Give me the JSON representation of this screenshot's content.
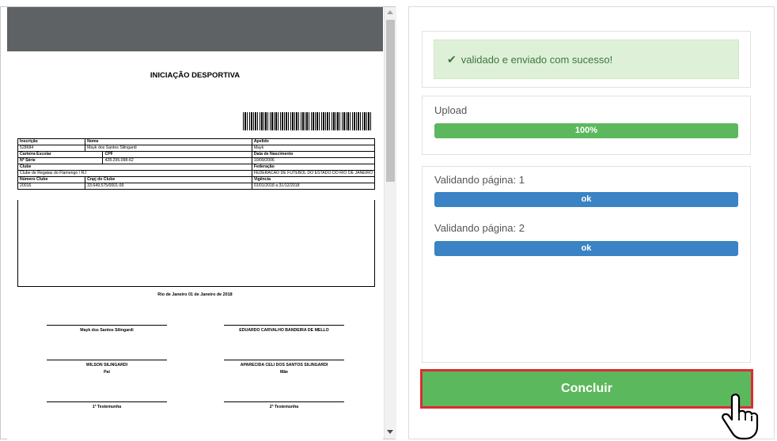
{
  "document": {
    "title": "INICIAÇÃO DESPORTIVA",
    "rows": [
      [
        {
          "t": "Inscrição",
          "h": true
        },
        {
          "t": "Nome",
          "h": true,
          "c": 2
        },
        {
          "t": "Apelido",
          "h": true
        }
      ],
      [
        {
          "t": "528684"
        },
        {
          "t": "Mayk dos Santos Silingardi",
          "c": 2
        },
        {
          "t": "Mayk"
        }
      ],
      [
        {
          "t": "Carteira Escolar",
          "h": true,
          "c": 2
        },
        {
          "t": "CPF",
          "h": true
        },
        {
          "t": "Data de Nascimento",
          "h": true
        }
      ],
      [
        {
          "t": "Nº Série",
          "h": true,
          "c": 2
        },
        {
          "t": "428.295.098-62"
        },
        {
          "t": "10/09/2006"
        }
      ],
      [
        {
          "t": "Clube",
          "h": true,
          "c": 3
        },
        {
          "t": "Federação",
          "h": true
        }
      ],
      [
        {
          "t": "Clube de Regatas do Flamengo / RJ",
          "c": 3
        },
        {
          "t": "FEDERACAO DE FUTEBOL DO ESTADO DO RIO DE JANEIRO"
        }
      ],
      [
        {
          "t": "Número Clube",
          "h": true
        },
        {
          "t": "Cnpj do Clube",
          "h": true,
          "c": 2
        },
        {
          "t": "Vigência",
          "h": true
        }
      ],
      [
        {
          "t": "20016"
        },
        {
          "t": "33.649.575/0001-99",
          "c": 2
        },
        {
          "t": "01/01/2018 a 31/12/2018"
        }
      ]
    ],
    "place_date": "Rio de Janeiro   01 de Janeiro de 2018",
    "signatures": {
      "s1": "Mayk dos Santos Silingardi",
      "s2": "EDUARDO CARVALHO BANDEIRA DE MELLO",
      "s3": "WILSON SILINGARDI",
      "s3_sub": "Pai",
      "s4": "APARECIDA CELI DOS SANTOS SILINGARDI",
      "s4_sub": "Mãe",
      "s5": "1ª Testemunha",
      "s6": "2ª Testemunha"
    }
  },
  "status": {
    "success_message": "validado e enviado com sucesso!",
    "upload_label": "Upload",
    "upload_progress": 100,
    "upload_progress_text": "100%",
    "validation": [
      {
        "label": "Validando página: 1",
        "result": "ok"
      },
      {
        "label": "Validando página: 2",
        "result": "ok"
      }
    ]
  },
  "actions": {
    "conclude_label": "Concluir"
  },
  "colors": {
    "success": "#5cb85c",
    "info": "#3a83c4",
    "highlight": "#dd2c34",
    "alert_bg": "#dff0d8"
  },
  "icons": {
    "success": "check-icon",
    "cursor": "hand-pointer-icon"
  }
}
